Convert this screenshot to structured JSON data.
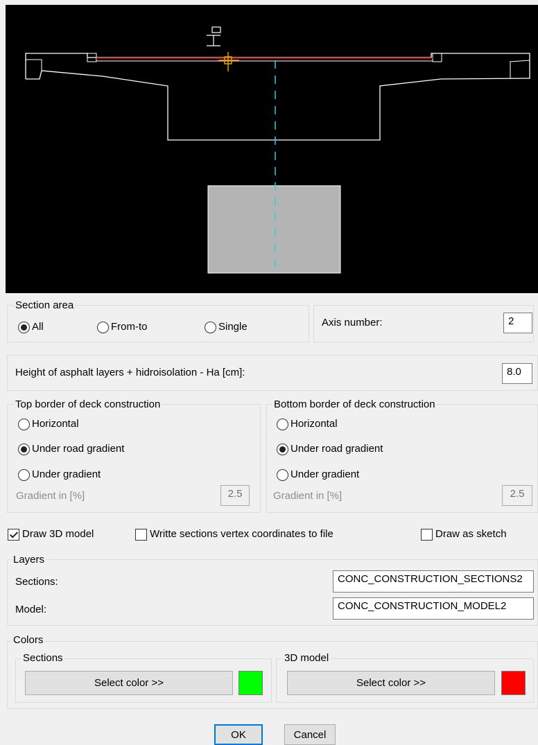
{
  "section_area": {
    "legend": "Section area",
    "options": [
      {
        "label": "All",
        "selected": true
      },
      {
        "label": "From-to",
        "selected": false
      },
      {
        "label": "Single",
        "selected": false
      }
    ]
  },
  "axis": {
    "label": "Axis number:",
    "value": "2"
  },
  "asphalt": {
    "label": "Height of asphalt layers + hidroisolation - Ha [cm]:",
    "value": "8.0"
  },
  "top_border": {
    "legend": "Top border of deck construction",
    "options": [
      {
        "label": "Horizontal",
        "selected": false
      },
      {
        "label": "Under road gradient",
        "selected": true
      },
      {
        "label": "Under gradient",
        "selected": false
      }
    ],
    "gradient_label": "Gradient in [%]",
    "gradient_value": "2.5"
  },
  "bottom_border": {
    "legend": "Bottom border of deck construction",
    "options": [
      {
        "label": "Horizontal",
        "selected": false
      },
      {
        "label": "Under road gradient",
        "selected": true
      },
      {
        "label": "Under gradient",
        "selected": false
      }
    ],
    "gradient_label": "Gradient in [%]",
    "gradient_value": "2.5"
  },
  "checks": {
    "draw_3d": {
      "label": "Draw 3D model",
      "checked": true
    },
    "write_coords": {
      "label": "Writte sections vertex coordinates to file",
      "checked": false
    },
    "sketch": {
      "label": "Draw as sketch",
      "checked": false
    }
  },
  "layers": {
    "legend": "Layers",
    "sections_label": "Sections:",
    "sections_value": "CONC_CONSTRUCTION_SECTIONS2",
    "model_label": "Model:",
    "model_value": "CONC_CONSTRUCTION_MODEL2"
  },
  "colors": {
    "legend": "Colors",
    "sections": {
      "legend": "Sections",
      "button": "Select color >>",
      "swatch": "#00ff00"
    },
    "model": {
      "legend": "3D model",
      "button": "Select color >>",
      "swatch": "#ff0000"
    }
  },
  "buttons": {
    "ok": "OK",
    "cancel": "Cancel"
  },
  "preview": {
    "ucs_label": "UCS",
    "section_color": "#ffffff",
    "road_color": "#b01010",
    "axis_color": "#3ec8e0",
    "pier_color": "#b4b4b4"
  }
}
